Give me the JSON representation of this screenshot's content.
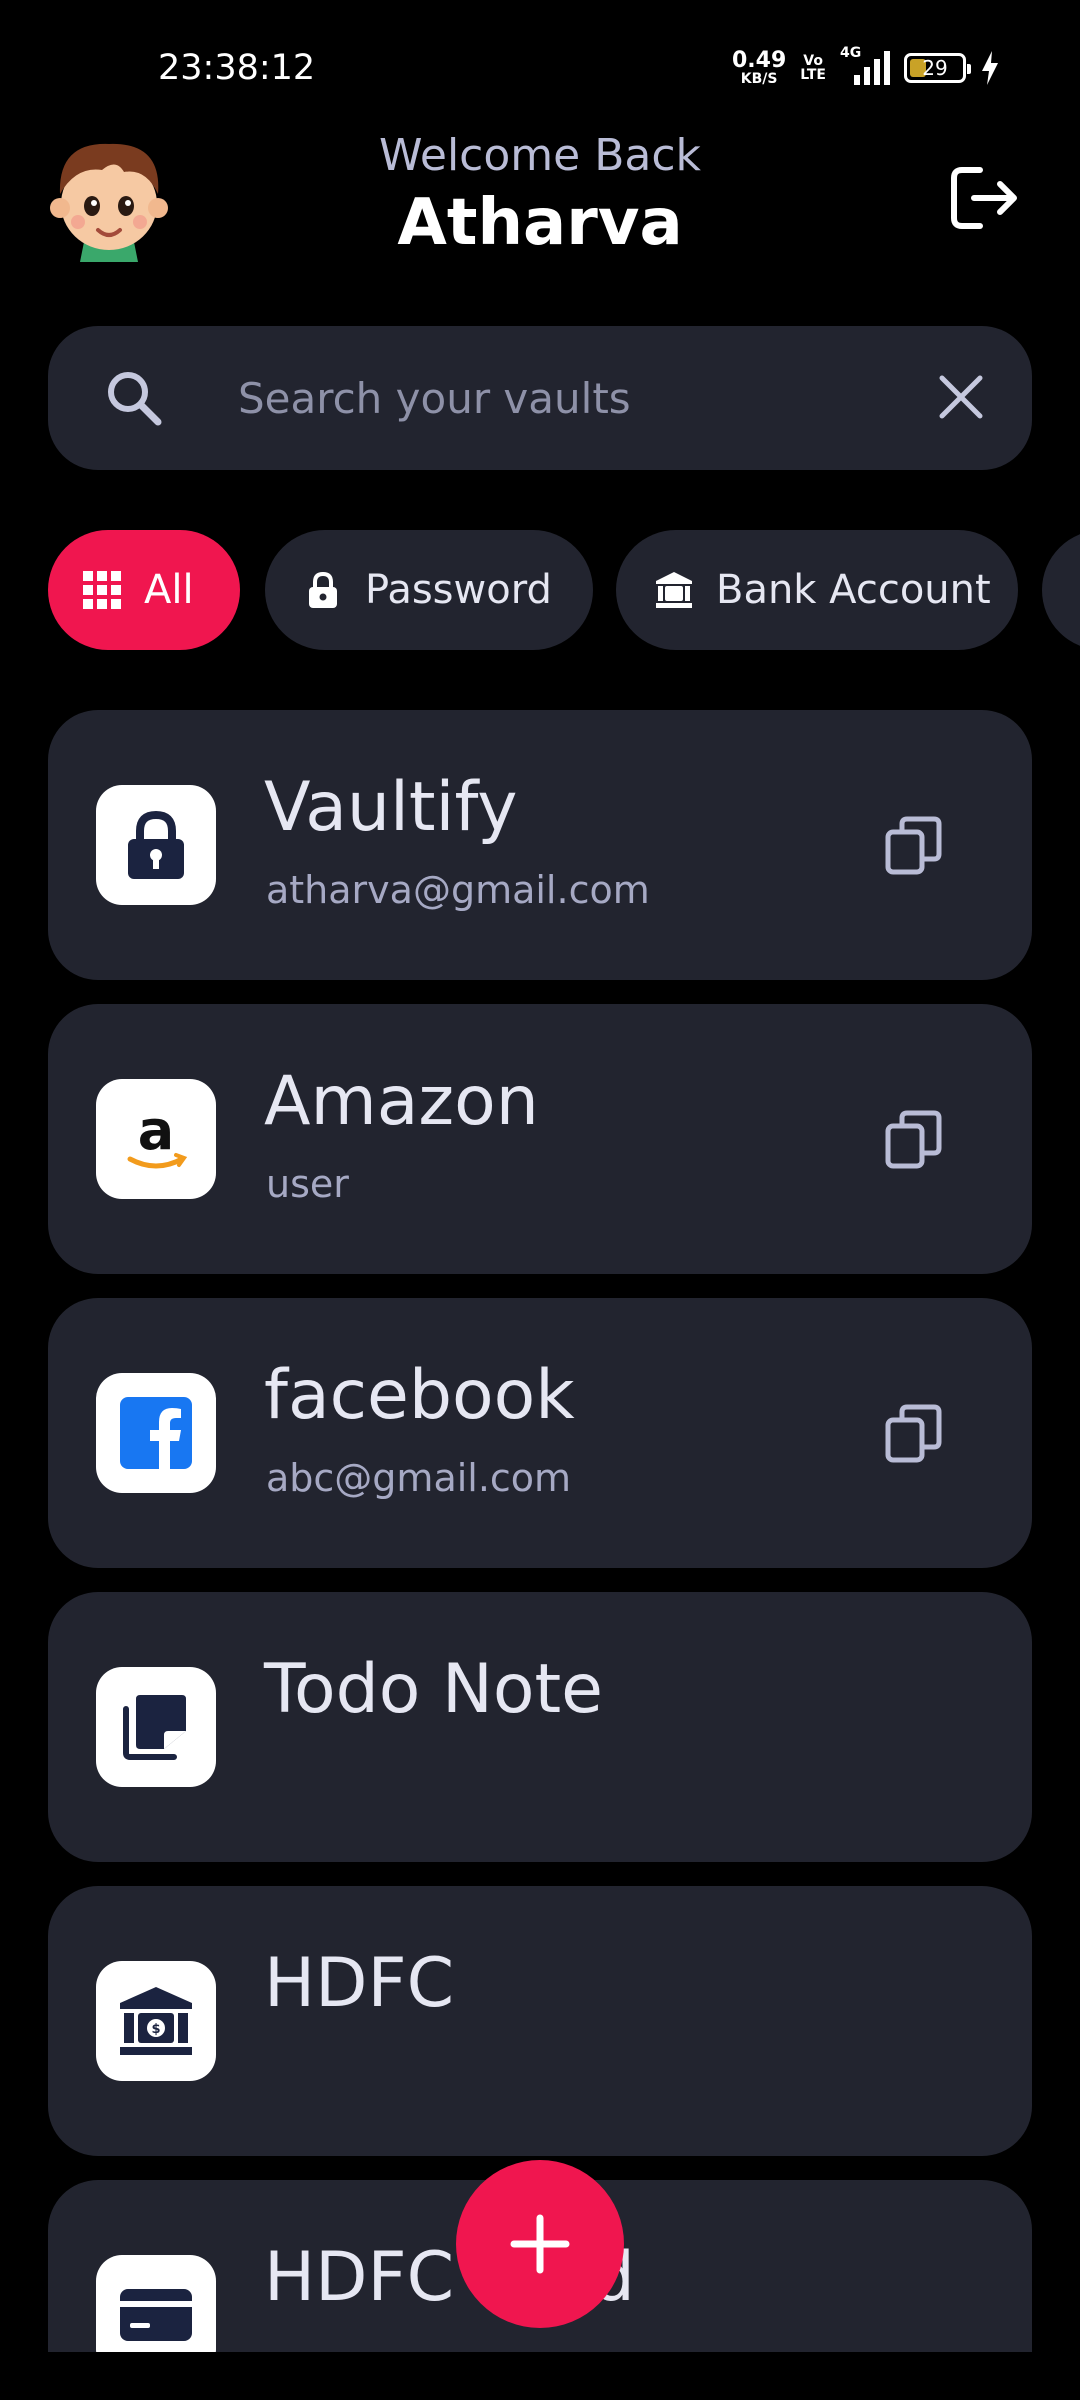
{
  "status_bar": {
    "time": "23:38:12",
    "net_speed_value": "0.49",
    "net_speed_unit": "KB/S",
    "volte_top": "Vo",
    "volte_bottom": "LTE",
    "network": "4G",
    "battery": "29"
  },
  "header": {
    "welcome": "Welcome Back",
    "username": "Atharva"
  },
  "search": {
    "placeholder": "Search your vaults"
  },
  "filters": [
    {
      "label": "All",
      "icon": "grid-icon",
      "active": true
    },
    {
      "label": "Password",
      "icon": "lock-icon",
      "active": false
    },
    {
      "label": "Bank Account",
      "icon": "bank-icon",
      "active": false
    }
  ],
  "vaults": [
    {
      "title": "Vaultify",
      "subtitle": "atharva@gmail.com",
      "icon": "lock-icon",
      "copyable": true
    },
    {
      "title": "Amazon",
      "subtitle": "user",
      "icon": "amazon-logo-icon",
      "copyable": true
    },
    {
      "title": "facebook",
      "subtitle": "abc@gmail.com",
      "icon": "facebook-logo-icon",
      "copyable": true
    },
    {
      "title": "Todo Note",
      "subtitle": "",
      "icon": "note-icon",
      "copyable": false
    },
    {
      "title": "HDFC",
      "subtitle": "",
      "icon": "bank-icon",
      "copyable": false
    },
    {
      "title": "HDFC Card",
      "subtitle": "",
      "icon": "credit-card-icon",
      "copyable": false
    }
  ],
  "colors": {
    "background": "#000000",
    "card": "#22242f",
    "accent": "#f0164f",
    "icon_navy": "#1b2340"
  }
}
